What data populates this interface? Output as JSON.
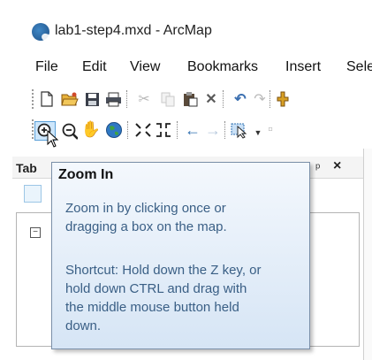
{
  "window": {
    "title": "lab1-step4.mxd - ArcMap"
  },
  "menu": [
    "File",
    "Edit",
    "View",
    "Bookmarks",
    "Insert",
    "Sele"
  ],
  "panel": {
    "title": "Tab"
  },
  "tooltip": {
    "title": "Zoom In",
    "lines": [
      "Zoom in by clicking once or",
      "dragging a box on the map.",
      "",
      "Shortcut: Hold down the Z key, or",
      "hold down CTRL and drag with",
      "the middle mouse button held",
      "down."
    ]
  },
  "icons": {
    "toolbar1": [
      "new-document-icon",
      "open-folder-icon",
      "save-icon",
      "print-icon",
      "cut-icon",
      "copy-icon",
      "paste-icon",
      "delete-icon",
      "undo-icon",
      "redo-icon",
      "add-data-icon"
    ],
    "toolbar2": [
      "zoom-in-icon",
      "zoom-out-icon",
      "pan-hand-icon",
      "full-extent-globe-icon",
      "fixed-zoom-in-icon",
      "fixed-zoom-out-icon",
      "back-arrow-icon",
      "forward-arrow-icon",
      "select-features-icon",
      "clear-selection-icon"
    ]
  },
  "colors": {
    "tooltip_text": "#3a5f85",
    "accent": "#2f6fb0"
  }
}
